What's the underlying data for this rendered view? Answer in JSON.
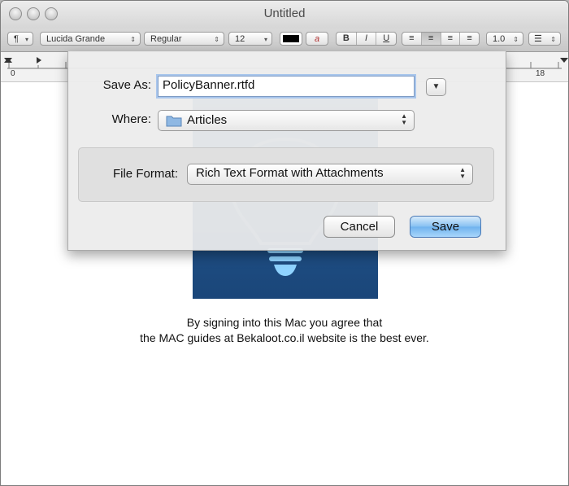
{
  "window": {
    "title": "Untitled"
  },
  "toolbar": {
    "paragraph_symbol": "¶",
    "font_family": "Lucida Grande",
    "font_style": "Regular",
    "font_size": "12",
    "align_buttons": [
      "≡",
      "≡",
      "≡",
      "≡"
    ],
    "line_spacing": "1.0",
    "bold": "B",
    "italic": "I",
    "underline": "U"
  },
  "ruler": {
    "start": "0",
    "end": "18"
  },
  "save_dialog": {
    "save_as_label": "Save As:",
    "filename": "PolicyBanner.rtfd",
    "where_label": "Where:",
    "where_value": "Articles",
    "file_format_label": "File Format:",
    "file_format_value": "Rich Text Format with Attachments",
    "cancel_label": "Cancel",
    "save_label": "Save"
  },
  "document": {
    "line1": "By signing into this Mac you agree that",
    "line2": "the MAC guides at Bekaloot.co.il website is the best ever."
  },
  "colors": {
    "banner": "#1f4f85",
    "default_button": "#6fb2ee"
  },
  "icons": [
    "folder-icon",
    "disclosure-triangle-icon",
    "bulb-icon"
  ]
}
